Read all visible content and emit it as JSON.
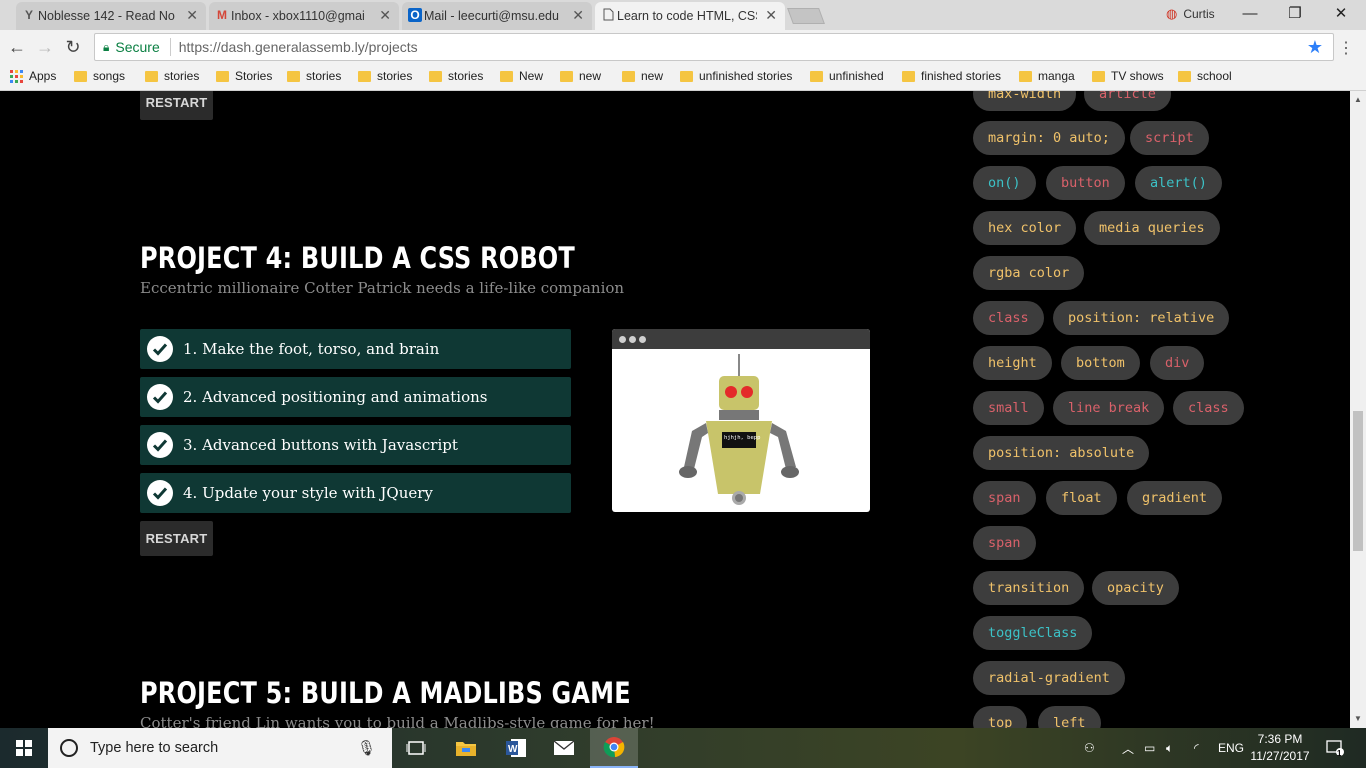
{
  "browser": {
    "tabs": [
      {
        "title": "Noblesse 142 - Read No",
        "icon": "Y",
        "active": false
      },
      {
        "title": "Inbox - xbox1110@gmai",
        "icon": "M",
        "active": false
      },
      {
        "title": "Mail - leecurti@msu.edu",
        "icon": "O",
        "active": false
      },
      {
        "title": "Learn to code HTML, CSS",
        "icon": "page",
        "active": true
      }
    ],
    "profile_name": "Curtis",
    "secure_label": "Secure",
    "url": "https://dash.generalassemb.ly/projects",
    "bookmarks": [
      "Apps",
      "songs",
      "stories",
      "Stories",
      "stories",
      "stories",
      "stories",
      "New",
      "new",
      "new",
      "unfinished stories",
      "unfinished",
      "finished stories",
      "manga",
      "TV shows",
      "school"
    ]
  },
  "page": {
    "restart_label": "RESTART",
    "project4": {
      "title": "PROJECT 4: BUILD A CSS ROBOT",
      "subtitle": "Eccentric millionaire Cotter Patrick needs a life-like companion",
      "tasks": [
        "1. Make the foot, torso, and brain",
        "2. Advanced positioning and animations",
        "3. Advanced buttons with Javascript",
        "4. Update your style with JQuery"
      ],
      "robot_screen_text": "hjhjh, bepp"
    },
    "project5": {
      "title": "PROJECT 5: BUILD A MADLIBS GAME",
      "subtitle": "Cotter's friend Lin wants you to build a Madlibs-style game for her!"
    },
    "tags": [
      {
        "label": "max-width",
        "color": "yellow"
      },
      {
        "label": "article",
        "color": "red"
      },
      {
        "label": "margin: 0 auto;",
        "color": "yellow"
      },
      {
        "label": "script",
        "color": "red"
      },
      {
        "label": "on()",
        "color": "cyan"
      },
      {
        "label": "button",
        "color": "red"
      },
      {
        "label": "alert()",
        "color": "cyan"
      },
      {
        "label": "hex color",
        "color": "yellow"
      },
      {
        "label": "media queries",
        "color": "yellow"
      },
      {
        "label": "rgba color",
        "color": "yellow"
      },
      {
        "label": "class",
        "color": "red"
      },
      {
        "label": "position: relative",
        "color": "yellow"
      },
      {
        "label": "height",
        "color": "yellow"
      },
      {
        "label": "bottom",
        "color": "yellow"
      },
      {
        "label": "div",
        "color": "red"
      },
      {
        "label": "small",
        "color": "red"
      },
      {
        "label": "line break",
        "color": "red"
      },
      {
        "label": "class",
        "color": "red"
      },
      {
        "label": "position: absolute",
        "color": "yellow"
      },
      {
        "label": "span",
        "color": "red"
      },
      {
        "label": "float",
        "color": "yellow"
      },
      {
        "label": "gradient",
        "color": "yellow"
      },
      {
        "label": "span",
        "color": "red"
      },
      {
        "label": "transition",
        "color": "yellow"
      },
      {
        "label": "opacity",
        "color": "yellow"
      },
      {
        "label": "toggleClass",
        "color": "cyan"
      },
      {
        "label": "radial-gradient",
        "color": "yellow"
      },
      {
        "label": "top",
        "color": "yellow"
      },
      {
        "label": "left",
        "color": "yellow"
      }
    ]
  },
  "taskbar": {
    "search_placeholder": "Type here to search",
    "language": "ENG",
    "time": "7:36 PM",
    "date": "11/27/2017",
    "notification_count": "1"
  },
  "colors": {
    "task_bg": "#0f3834",
    "tag_bg": "#3d3d3d",
    "tag_yellow": "#f0c26a",
    "tag_red": "#d9616a",
    "tag_cyan": "#3cc2c7"
  }
}
